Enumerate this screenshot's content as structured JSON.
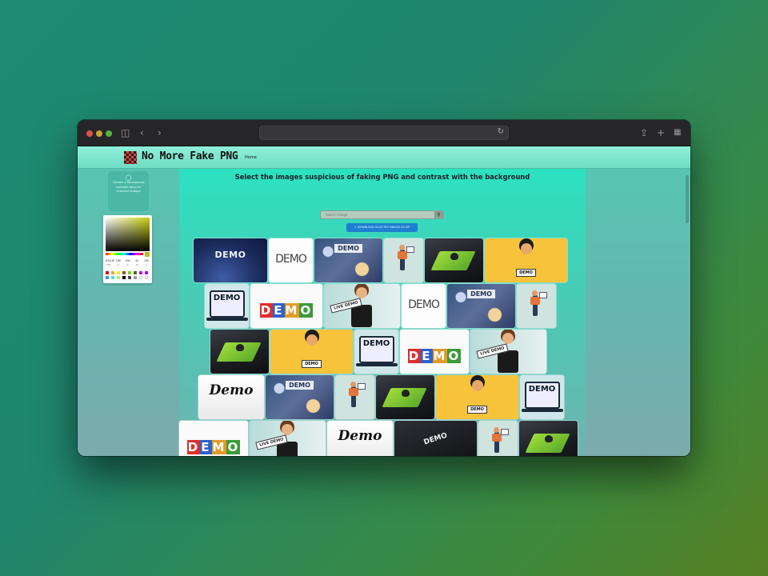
{
  "browser": {
    "sidebar_icon": "sidebar-icon",
    "back_icon": "chevron-left-icon",
    "forward_icon": "chevron-right-icon",
    "reload_icon": "reload-icon",
    "share_icon": "share-icon",
    "new_tab_icon": "plus-icon",
    "tabs_icon": "grid-icon",
    "address": ""
  },
  "site": {
    "brand": "No More Fake PNG",
    "nav_home": "Home"
  },
  "sidebar": {
    "tip_icon": "lightbulb-icon",
    "tip_text": "Choose a background contrast color for selected images",
    "picker": {
      "selected_color": "#b4c22a",
      "values": [
        "b3c1f5",
        "180",
        "194",
        "42",
        "100"
      ],
      "labels": [
        "HEX",
        "R",
        "G",
        "B",
        "A"
      ],
      "presets": [
        "#d0021b",
        "#f5a623",
        "#f8e71c",
        "#8b572a",
        "#7ed321",
        "#417505",
        "#bd10e0",
        "#9013fe",
        "#4a90e2",
        "#50e3c2",
        "#b8e986",
        "#000000",
        "#4a4a4a",
        "#9b9b9b",
        "#ffffff",
        "#ffffff"
      ]
    }
  },
  "main": {
    "heading": "Select the images suspicious of faking PNG and contrast with the background",
    "search_placeholder": "Search image",
    "search_icon": "search-icon",
    "download_label": "DOWNLOAD SELECTED IMAGES AS ZIP",
    "download_icon": "download-icon"
  },
  "images": {
    "demo_text": "DEMO",
    "script_text": "Demo",
    "live_demo_text": "LIVE DEMO"
  }
}
